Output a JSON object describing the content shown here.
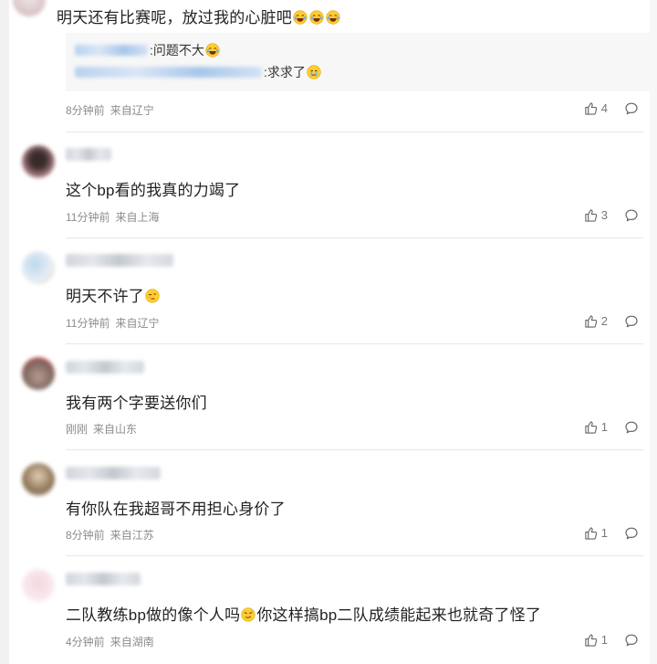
{
  "comments": [
    {
      "text": "明天还有比赛呢，放过我的心脏吧",
      "emojis": [
        "laugh-cry-emoji",
        "laugh-cry-emoji",
        "laugh-cry-emoji"
      ],
      "replies": [
        {
          "text": ":问题不大"
        },
        {
          "text": ":求求了"
        }
      ],
      "time": "8分钟前",
      "location": "来自辽宁",
      "likes": "4"
    },
    {
      "text": "这个bp看的我真的力竭了",
      "time": "11分钟前",
      "location": "来自上海",
      "likes": "3"
    },
    {
      "text": "明天不许了",
      "time": "11分钟前",
      "location": "来自辽宁",
      "likes": "2"
    },
    {
      "text": "我有两个字要送你们",
      "time": "刚刚",
      "location": "来自山东",
      "likes": "1"
    },
    {
      "text": "有你队在我超哥不用担心身价了",
      "time": "8分钟前",
      "location": "来自江苏",
      "likes": "1"
    },
    {
      "text_part1": "二队教练bp做的像个人吗",
      "text_part2": "你这样搞bp二队成绩能起来也就奇了怪了",
      "time": "4分钟前",
      "location": "来自湖南",
      "likes": "1"
    }
  ],
  "colors": {
    "text": "#222222",
    "meta": "#8c8c8c",
    "quote_bg": "#f7f7f7",
    "blur_link": "#a7c6ea"
  }
}
